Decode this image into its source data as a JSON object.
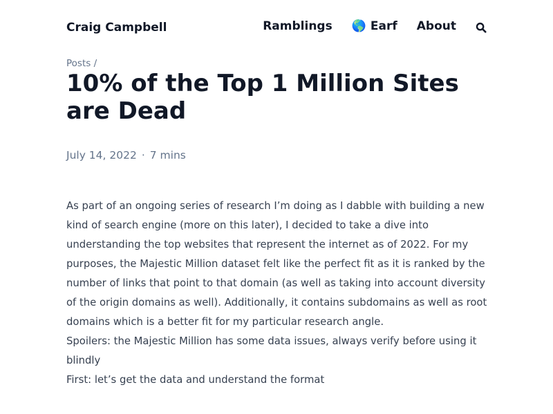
{
  "header": {
    "site_title": "Craig Campbell",
    "nav": {
      "ramblings": "Ramblings",
      "earf_emoji": "🌎",
      "earf": "Earf",
      "about": "About"
    },
    "search_icon": "search-icon"
  },
  "breadcrumb": {
    "posts": "Posts",
    "separator": "/"
  },
  "post": {
    "title": "10% of the Top 1 Million Sites are Dead",
    "date": "July 14, 2022",
    "separator": "·",
    "read_time": "7 mins",
    "paragraphs": [
      "As part of an ongoing series of research I’m doing as I dabble with building a new kind of search engine (more on this later), I decided to take a dive into understanding the top websites that represent the internet as of 2022. For my purposes, the Majestic Million dataset felt like the perfect fit as it is ranked by the number of links that point to that domain (as well as taking into account diversity of the origin domains as well). Additionally, it contains subdomains as well as root domains which is a better fit for my particular research angle.",
      "Spoilers: the Majestic Million has some data issues, always verify before using it blindly",
      "First: let’s get the data and understand the format"
    ]
  },
  "colors": {
    "heading": "#111827",
    "body_text": "#374151",
    "muted": "#64748b",
    "background": "#ffffff"
  }
}
